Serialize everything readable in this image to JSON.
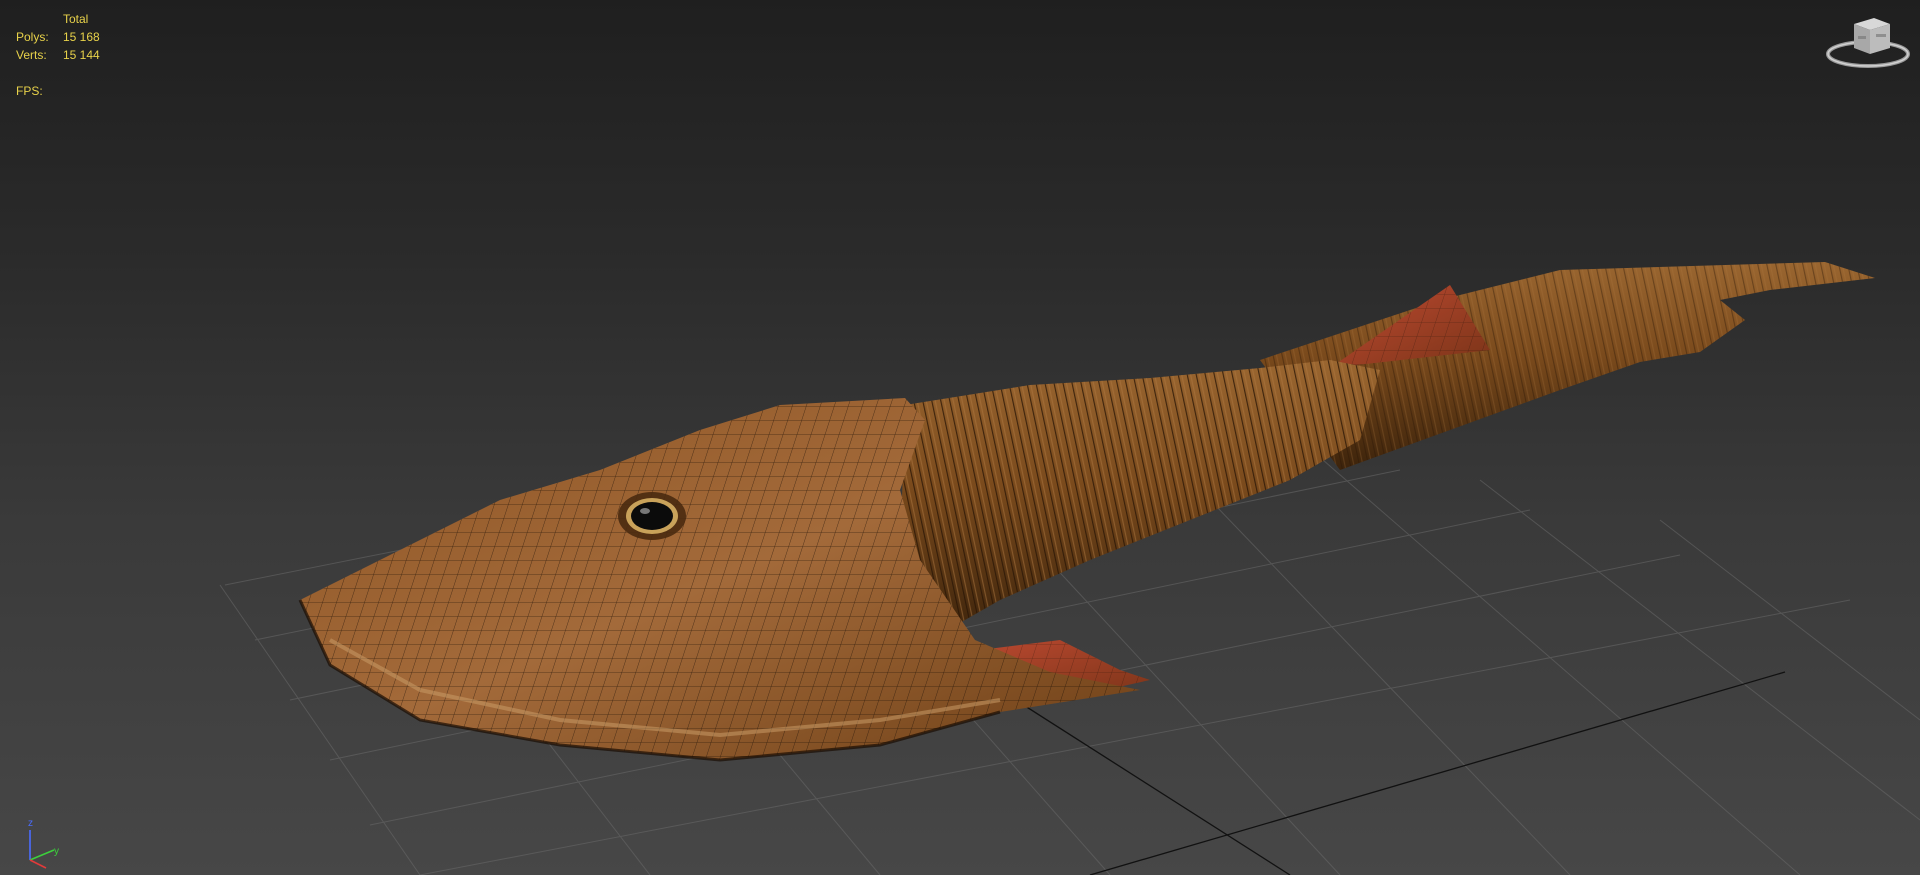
{
  "viewport": {
    "stats": {
      "header": "Total",
      "polys_label": "Polys:",
      "polys_value": "15 168",
      "verts_label": "Verts:",
      "verts_value": "15 144",
      "fps_label": "FPS:"
    },
    "viewcube": {
      "icon": "viewcube-icon"
    },
    "axis_tripod": {
      "icon": "axis-tripod-icon",
      "z_label": "z",
      "y_label": "y",
      "colors": {
        "z": "#4a6cff",
        "y": "#3ccf3c",
        "x": "#e23a3a"
      }
    },
    "grid": {
      "visible": true,
      "color": "#6a6a6a"
    },
    "model": {
      "name": "prehistoric-fish-mesh",
      "wireframe_on_shaded": true,
      "colors": {
        "skin_dark": "#5a3310",
        "skin_mid": "#8a5420",
        "skin_light": "#a9713a",
        "fin_red": "#b5432e"
      }
    }
  }
}
